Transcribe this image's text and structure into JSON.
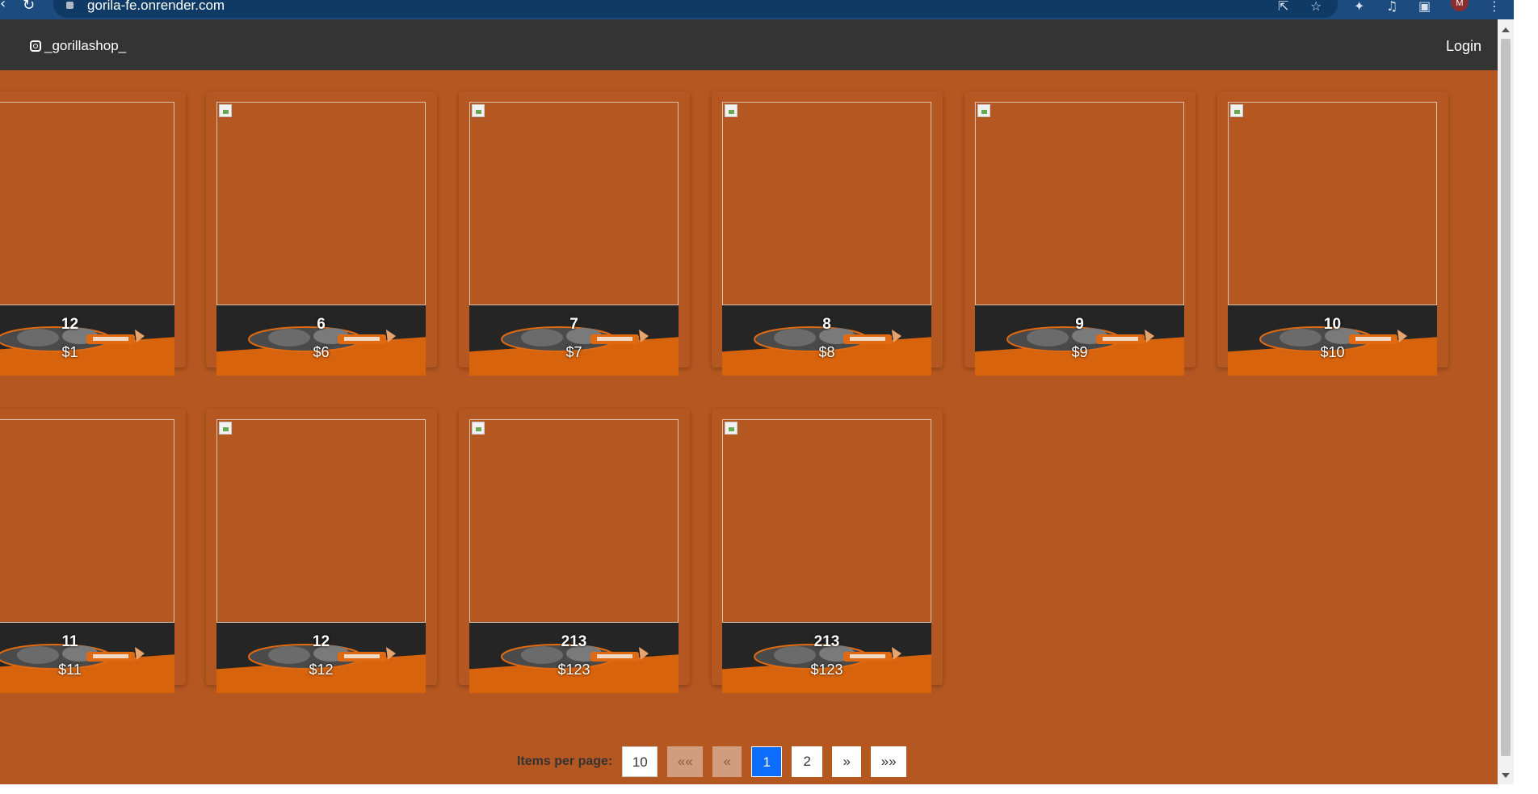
{
  "browser": {
    "url": "gorila-fe.onrender.com",
    "avatar_letter": "M"
  },
  "navbar": {
    "brand": "_gorillashop_",
    "login": "Login"
  },
  "products": [
    {
      "name": "12",
      "price": "$1"
    },
    {
      "name": "6",
      "price": "$6"
    },
    {
      "name": "7",
      "price": "$7"
    },
    {
      "name": "8",
      "price": "$8"
    },
    {
      "name": "9",
      "price": "$9"
    },
    {
      "name": "10",
      "price": "$10"
    },
    {
      "name": "11",
      "price": "$11"
    },
    {
      "name": "12",
      "price": "$12"
    },
    {
      "name": "213",
      "price": "$123"
    },
    {
      "name": "213",
      "price": "$123"
    }
  ],
  "pagination": {
    "label": "Items per page:",
    "per_page": "10",
    "first": "««",
    "prev": "«",
    "page1": "1",
    "page2": "2",
    "next": "»",
    "last": "»»"
  },
  "colors": {
    "background": "#b55720",
    "navbar": "#343434",
    "active_page": "#0d6efd"
  }
}
